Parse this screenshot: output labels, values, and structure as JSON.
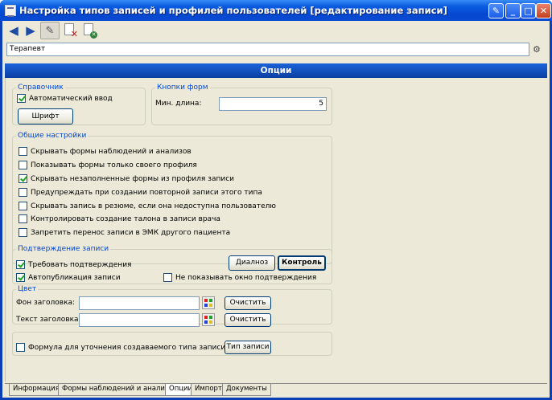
{
  "window": {
    "title": "Настройка типов записей и профилей пользователей [редактирование записи]"
  },
  "record": {
    "name_value": "Терапевт"
  },
  "options_header": "Опции",
  "reference": {
    "legend": "Справочник",
    "auto_input_label": "Автоматический ввод",
    "auto_input_checked": true,
    "font_button": "Шрифт"
  },
  "form_buttons": {
    "legend": "Кнопки форм",
    "min_length_label": "Мин. длина:",
    "min_length_value": "5"
  },
  "general": {
    "legend": "Общие настройки",
    "items": [
      {
        "label": "Скрывать формы наблюдений и анализов",
        "checked": false
      },
      {
        "label": "Показывать формы только своего профиля",
        "checked": false
      },
      {
        "label": "Скрывать незаполненные формы из профиля записи",
        "checked": true
      },
      {
        "label": "Предупреждать при создании повторной записи этого типа",
        "checked": false
      },
      {
        "label": "Скрывать запись в резюме, если она недоступна пользователю",
        "checked": false
      },
      {
        "label": "Контролировать создание талона в записи врача",
        "checked": false
      },
      {
        "label": "Запретить перенос записи в  ЭМК другого пациента",
        "checked": false
      }
    ]
  },
  "confirmation": {
    "legend": "Подтверждение записи",
    "require_label": "Требовать подтверждения",
    "require_checked": true,
    "autopublish_label": "Автопубликация записи",
    "autopublish_checked": true,
    "hide_window_label": "Не показывать окно подтверждения",
    "hide_window_checked": false,
    "diagnosis_button": "Диалноз",
    "control_button": "Контроль"
  },
  "color": {
    "legend": "Цвет",
    "header_bg_label": "Фон заголовка:",
    "header_text_label": "Текст заголовка:",
    "clear_button": "Очистить"
  },
  "formula": {
    "label": "Формула для уточнения создаваемого типа записи",
    "checked": false,
    "record_type_button": "Тип записи"
  },
  "tabs": [
    {
      "label": "Информация",
      "active": false
    },
    {
      "label": "Формы наблюдений и анализов",
      "active": false
    },
    {
      "label": "Опции",
      "active": true
    },
    {
      "label": "Импорт",
      "active": false
    },
    {
      "label": "Документы",
      "active": false
    }
  ],
  "icons": {
    "back": "arrow-left-icon",
    "forward": "arrow-right-icon",
    "edit": "pencil-icon",
    "delete": "delete-document-icon",
    "close_doc": "close-document-icon",
    "lookup": "lookup-icon"
  }
}
